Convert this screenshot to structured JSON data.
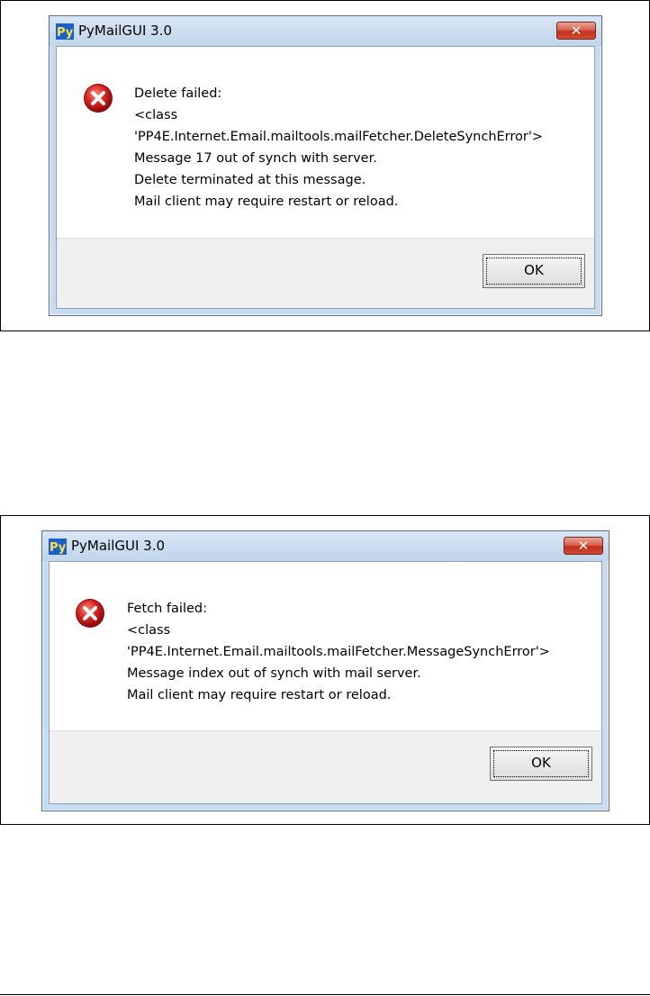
{
  "dialogs": [
    {
      "title": "PyMailGUI 3.0",
      "close_label": "✕",
      "message_lines": [
        "Delete failed:",
        "<class",
        "'PP4E.Internet.Email.mailtools.mailFetcher.DeleteSynchError'>",
        "Message 17 out of synch with server.",
        "Delete terminated at this message.",
        "Mail client may require restart or reload."
      ],
      "ok_label": "OK",
      "icon": "error-icon"
    },
    {
      "title": "PyMailGUI 3.0",
      "close_label": "✕",
      "message_lines": [
        "Fetch failed:",
        "<class",
        "'PP4E.Internet.Email.mailtools.mailFetcher.MessageSynchError'>",
        "Message index out of synch with mail server.",
        "Mail client may require restart or reload."
      ],
      "ok_label": "OK",
      "icon": "error-icon"
    }
  ],
  "colors": {
    "titlebar": "#c9dcef",
    "close_button": "#c2301c",
    "button_area": "#f0f0f0",
    "error_icon": "#c8101a"
  }
}
